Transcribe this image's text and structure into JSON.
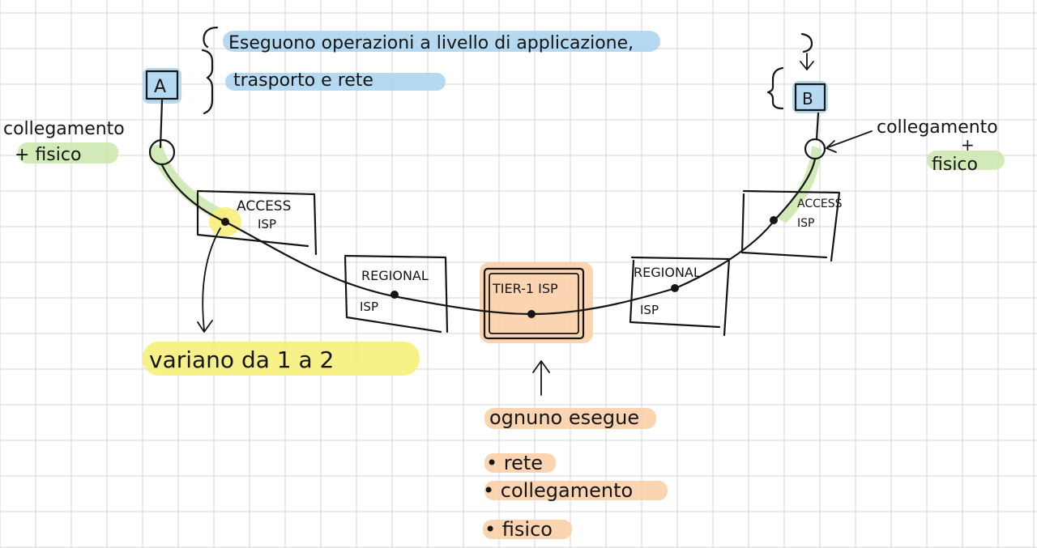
{
  "notes": {
    "top_line1": "Eseguono operazioni a livello di applicazione,",
    "top_line2": "trasporto e rete",
    "host_a": "A",
    "host_b": "B",
    "left_label_line1": "collegamento",
    "left_label_line2": "+ fisico",
    "right_label_line1": "collegamento",
    "right_label_line2": "+",
    "right_label_line3": "fisico",
    "access_left_line1": "ACCESS",
    "access_left_line2": "ISP",
    "regional_left_line1": "REGIONAL",
    "regional_left_line2": "ISP",
    "tier1": "TIER-1 ISP",
    "regional_right_line1": "REGIONAL",
    "regional_right_line2": "ISP",
    "access_right_line1": "ACCESS",
    "access_right_line2": "ISP",
    "variano": "variano da 1 a 2",
    "ognuno": "ognuno esegue",
    "bullet1": "• rete",
    "bullet2": "• collegamento",
    "bullet3": "• fisico"
  },
  "colors": {
    "grid": "#d4d4d4",
    "ink": "#151515",
    "highlight_blue": "#a9d2f0",
    "highlight_green": "#cde8b0",
    "highlight_yellow": "#f6f07a",
    "highlight_orange": "#fbd0a8"
  }
}
